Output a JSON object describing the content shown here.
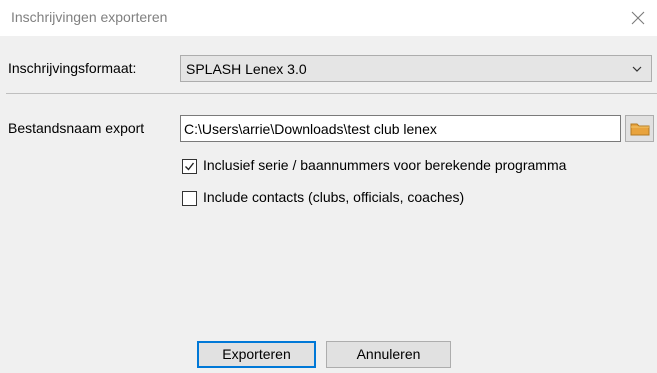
{
  "window": {
    "title": "Inschrijvingen exporteren",
    "close_icon": "close-icon"
  },
  "format": {
    "label": "Inschrijvingsformaat:",
    "selected": "SPLASH Lenex 3.0"
  },
  "export": {
    "filename_label": "Bestandsnaam export",
    "filename_value": "C:\\Users\\arrie\\Downloads\\test club lenex",
    "browse_icon": "folder-icon"
  },
  "options": {
    "include_series": {
      "label": "Inclusief serie / baannummers voor berekende programma",
      "checked": true
    },
    "include_contacts": {
      "label": "Include contacts (clubs, officials, coaches)",
      "checked": false
    }
  },
  "buttons": {
    "export_label": "Exporteren",
    "cancel_label": "Annuleren"
  },
  "colors": {
    "accent": "#0078d7",
    "panel": "#f0f0f0",
    "folder": "#e8a33d"
  }
}
